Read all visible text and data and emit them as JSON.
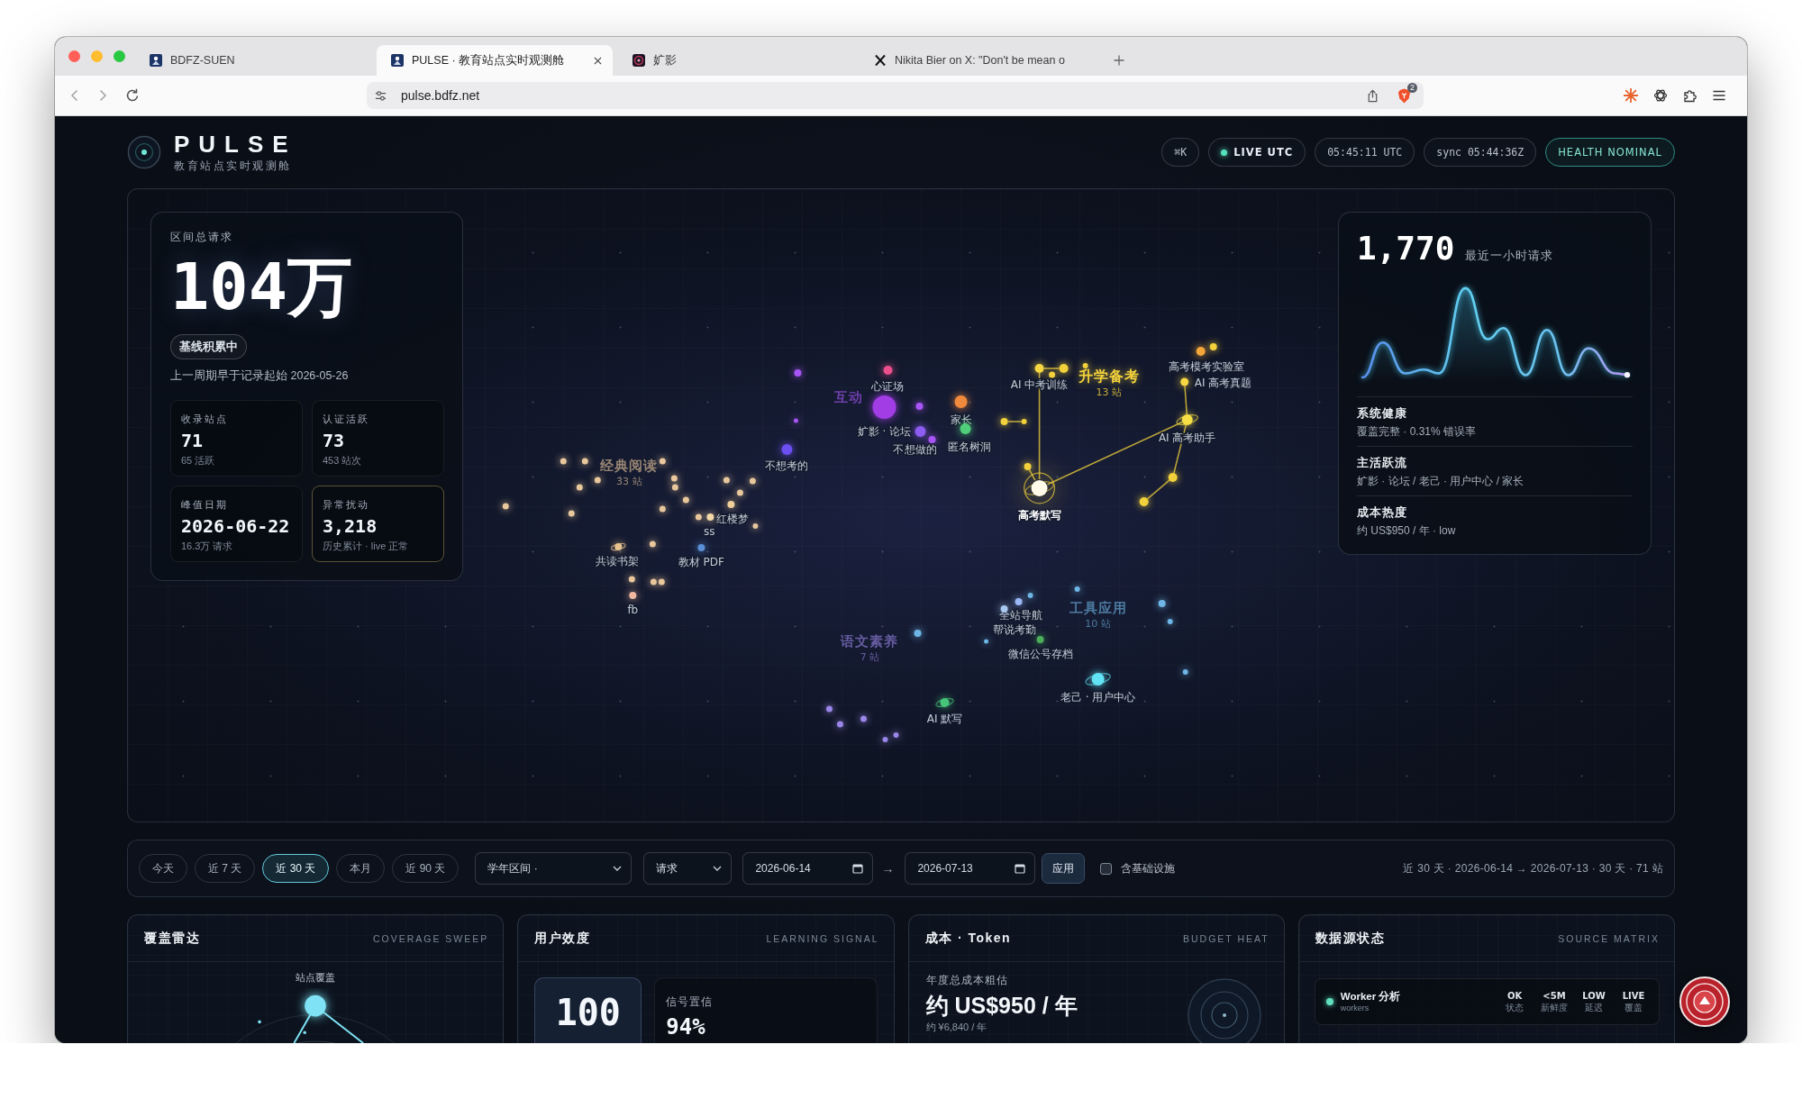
{
  "browser": {
    "tabs": [
      {
        "title": "BDFZ-SUEN",
        "kind": "square",
        "selected": false
      },
      {
        "title": "PULSE · 教育站点实时观测舱",
        "kind": "square",
        "selected": true
      },
      {
        "title": "㚧影",
        "kind": "round",
        "selected": false
      },
      {
        "title": "Nikita Bier on X: \"Don't be mean o",
        "kind": "x",
        "selected": false
      }
    ],
    "url": "pulse.bdfz.net",
    "extension_badge": "2"
  },
  "header": {
    "brand": "PULSE",
    "subtitle": "教育站点实时观测舱",
    "pills": [
      {
        "text": "⌘K",
        "kind": "key"
      },
      {
        "text": "LIVE UTC",
        "kind": "live"
      },
      {
        "text": "05:45:11 UTC",
        "kind": "plain"
      },
      {
        "text": "sync 05:44:36Z",
        "kind": "plain"
      },
      {
        "text": "HEALTH NOMINAL",
        "kind": "health"
      }
    ]
  },
  "summary": {
    "label": "区间总请求",
    "total": "104万",
    "badge": "基线积累中",
    "note": "上一周期早于记录起始 2026-05-26",
    "stats": [
      {
        "label": "收录站点",
        "value": "71",
        "sub": "65 活跃",
        "alert": false
      },
      {
        "label": "认证活跃",
        "value": "73",
        "sub": "453 站次",
        "alert": false
      },
      {
        "label": "峰值日期",
        "value": "2026-06-22",
        "sub": "16.3万 请求",
        "alert": false
      },
      {
        "label": "异常扰动",
        "value": "3,218",
        "sub": "历史累计 · live 正常",
        "alert": true
      }
    ]
  },
  "map": {
    "clusters": [
      {
        "label": "升学备考",
        "count": "13 站",
        "color": "#f2d13c",
        "selected": true,
        "nodes": [
          {
            "label": "AI 中考训练",
            "color": "#f7d843",
            "selected": false
          },
          {
            "label": "高考模考实验室",
            "color": "#f5a63a",
            "selected": false
          },
          {
            "label": "AI 高考真题",
            "color": "#f7d843",
            "selected": false
          },
          {
            "label": "AI 高考助手",
            "color": "#f7e046",
            "selected": false
          },
          {
            "label": "高考默写",
            "color": "#fffbe8",
            "selected": true
          }
        ]
      },
      {
        "label": "互动",
        "color": "#a855f7",
        "selected": false,
        "nodes": [
          {
            "label": "心证场",
            "color": "#ec4f8c",
            "selected": false
          },
          {
            "label": "㚧影 · 论坛",
            "color": "#a23de6",
            "selected": false
          },
          {
            "label": "家长",
            "color": "#f28a3d",
            "selected": false
          },
          {
            "label": "不想做的",
            "color": "#8d5cf0",
            "selected": false
          },
          {
            "label": "匿名树洞",
            "color": "#4fcf7a",
            "selected": false
          },
          {
            "label": "不想考的",
            "color": "#6b4ff2",
            "selected": false
          }
        ]
      },
      {
        "label": "经典阅读",
        "count": "33 站",
        "color": "#e9c79c",
        "selected": false,
        "nodes": [
          {
            "label": "红楼梦",
            "color": "#f0cf9a",
            "selected": false
          },
          {
            "label": "ss",
            "color": "#f3d8a8",
            "selected": false
          },
          {
            "label": "共读书架",
            "color": "#e8c38f",
            "selected": false
          },
          {
            "label": "教材 PDF",
            "color": "#5a8fd6",
            "selected": false
          },
          {
            "label": "fb",
            "color": "#f0b8a0",
            "selected": false
          }
        ]
      },
      {
        "label": "工具应用",
        "count": "10 站",
        "color": "#6fb6e6",
        "selected": false,
        "nodes": [
          {
            "label": "全站导航",
            "color": "#9ab8f5",
            "selected": false
          },
          {
            "label": "帮说考勤",
            "color": "#a8c8f0",
            "selected": false
          },
          {
            "label": "微信公号存档",
            "color": "#4caf5a",
            "selected": false
          },
          {
            "label": "老己 · 用户中心",
            "color": "#62e3f5",
            "selected": false
          }
        ]
      },
      {
        "label": "语文素养",
        "count": "7 站",
        "color": "#9a86e8",
        "selected": false,
        "nodes": [
          {
            "label": "AI 默写",
            "color": "#46c47a",
            "selected": false
          }
        ]
      }
    ]
  },
  "pulse": {
    "value": "1,770",
    "label": "最近一小时请求",
    "sections": [
      {
        "title": "系统健康",
        "text": "覆盖完整 · 0.31% 错误率"
      },
      {
        "title": "主活跃流",
        "text": "㚧影 · 论坛 / 老己 · 用户中心 / 家长"
      },
      {
        "title": "成本热度",
        "text": "约 US$950 / 年 · low"
      }
    ]
  },
  "filters": {
    "ranges": [
      {
        "label": "今天",
        "selected": false
      },
      {
        "label": "近 7 天",
        "selected": false
      },
      {
        "label": "近 30 天",
        "selected": true
      },
      {
        "label": "本月",
        "selected": false
      },
      {
        "label": "近 90 天",
        "selected": false
      }
    ],
    "term": "学年区间 ·",
    "metric": "请求",
    "start_date": "2026-06-14",
    "range_arrow": "→",
    "end_date": "2026-07-13",
    "apply": "应用",
    "include_infra": {
      "label": "含基础设施",
      "checked": false
    },
    "summary": "近 30 天 · 2026-06-14 → 2026-07-13 · 30 天 · 71 站"
  },
  "panels": [
    {
      "title": "覆盖雷达",
      "tag": "COVERAGE SWEEP",
      "kind": "radar",
      "label": "站点覆盖"
    },
    {
      "title": "用户效度",
      "tag": "LEARNING SIGNAL",
      "kind": "signal",
      "score": "100",
      "metric_label": "信号置信",
      "metric_value": "94%"
    },
    {
      "title": "成本 · Token",
      "tag": "BUDGET HEAT",
      "kind": "budget",
      "label": "年度总成本粗估",
      "value": "约 US$950 / 年",
      "sub": "约 ¥6,840 / 年"
    },
    {
      "title": "数据源状态",
      "tag": "SOURCE MATRIX",
      "kind": "sources",
      "rows": [
        {
          "name": "Worker 分析",
          "sub": "workers",
          "color": "#5fe0c0",
          "stats": [
            {
              "value": "OK",
              "label": "状态"
            },
            {
              "value": "<5M",
              "label": "新鲜度"
            },
            {
              "value": "LOW",
              "label": "延迟"
            },
            {
              "value": "LIVE",
              "label": "覆盖"
            }
          ]
        }
      ]
    }
  ]
}
